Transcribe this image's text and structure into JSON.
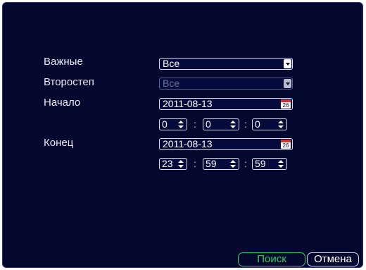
{
  "labels": {
    "important": "Важные",
    "secondary": "Второстеп",
    "start": "Начало",
    "end": "Конец"
  },
  "important_select": {
    "value": "Все"
  },
  "secondary_select": {
    "value": "Все"
  },
  "start": {
    "date": "2011-08-13",
    "calendar_day": "26",
    "hour": "0",
    "minute": "0",
    "second": "0"
  },
  "end": {
    "date": "2011-08-13",
    "calendar_day": "26",
    "hour": "23",
    "minute": "59",
    "second": "59"
  },
  "time_separator": ":",
  "buttons": {
    "search": "Поиск",
    "cancel": "Отмена"
  },
  "colors": {
    "background": "#04072e",
    "search_accent": "#2ed15c"
  }
}
